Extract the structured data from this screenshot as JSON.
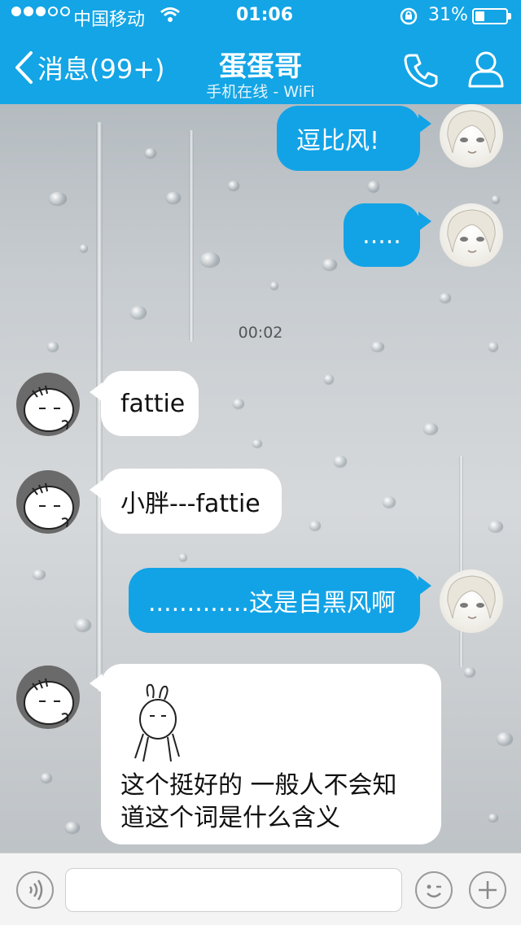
{
  "status_bar": {
    "carrier": "中国移动",
    "time": "01:06",
    "battery_percent": "31%",
    "battery_level": 0.31,
    "signal_bars_filled": 3,
    "signal_bars_total": 5
  },
  "nav": {
    "back_label": "消息(99+)",
    "title": "蛋蛋哥",
    "subtitle": "手机在线 - WiFi",
    "phone_icon": "phone-icon",
    "contact_icon": "person-icon"
  },
  "messages": [
    {
      "direction": "out",
      "text": "逗比风!",
      "avatar": "anime-girl-avatar"
    },
    {
      "direction": "out",
      "text": ".....",
      "avatar": "anime-girl-avatar"
    },
    {
      "type": "timestamp",
      "text": "00:02"
    },
    {
      "direction": "in",
      "text": "fattie",
      "avatar": "rabbit-avatar"
    },
    {
      "direction": "in",
      "text": "小胖---fattie",
      "avatar": "rabbit-avatar"
    },
    {
      "direction": "out",
      "text": ".............这是自黑风啊",
      "avatar": "anime-girl-avatar"
    },
    {
      "direction": "in",
      "text_line1": "这个挺好的  一般人不会知",
      "text_line2": "道这个词是什么含义",
      "sticker": "rabbit-sticker",
      "avatar": "rabbit-avatar"
    }
  ],
  "input_bar": {
    "voice_icon": "voice-icon",
    "input_value": "",
    "emoji_icon": "emoji-icon",
    "plus_icon": "plus-icon"
  },
  "colors": {
    "header": "#13a5e5",
    "outgoing_bubble": "#12a3e6",
    "incoming_bubble": "#ffffff"
  }
}
